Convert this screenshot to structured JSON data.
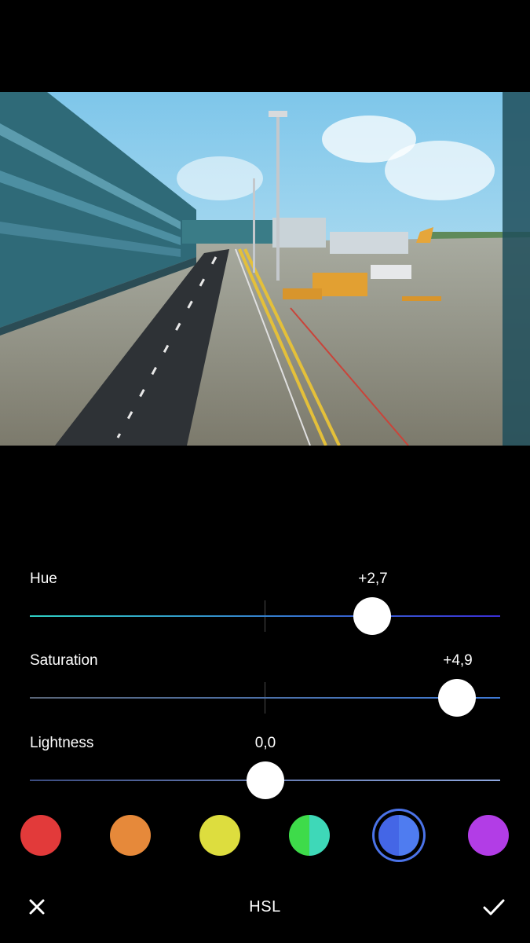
{
  "photo": {
    "subject": "airport-terminal-apron"
  },
  "sliders": [
    {
      "label": "Hue",
      "value": "+2,7",
      "level": 0.728,
      "track_from": "#2fd1c4",
      "track_to": "#3a2fd6"
    },
    {
      "label": "Saturation",
      "value": "+4,9",
      "level": 0.908,
      "track_from": "#5a6678",
      "track_to": "#3f7bd8"
    },
    {
      "label": "Lightness",
      "value": "0,0",
      "level": 0.5,
      "track_from": "#3b4c80",
      "track_to": "#8fa8e0"
    }
  ],
  "colors": [
    {
      "name": "red",
      "fill": "#e23a3a"
    },
    {
      "name": "orange",
      "fill": "#e6893a"
    },
    {
      "name": "yellow",
      "fill": "#dddd3e"
    },
    {
      "name": "green",
      "fill": "#3edb4a",
      "fill2": "#3ed8b8"
    },
    {
      "name": "blue",
      "fill": "#4466e6",
      "fill2": "#4f7cf0",
      "selected": true
    },
    {
      "name": "purple",
      "fill": "#b23de6"
    }
  ],
  "bottom_bar": {
    "title": "HSL",
    "close_icon": "close-icon",
    "confirm_icon": "check-icon"
  },
  "accent": "#4b73e8"
}
